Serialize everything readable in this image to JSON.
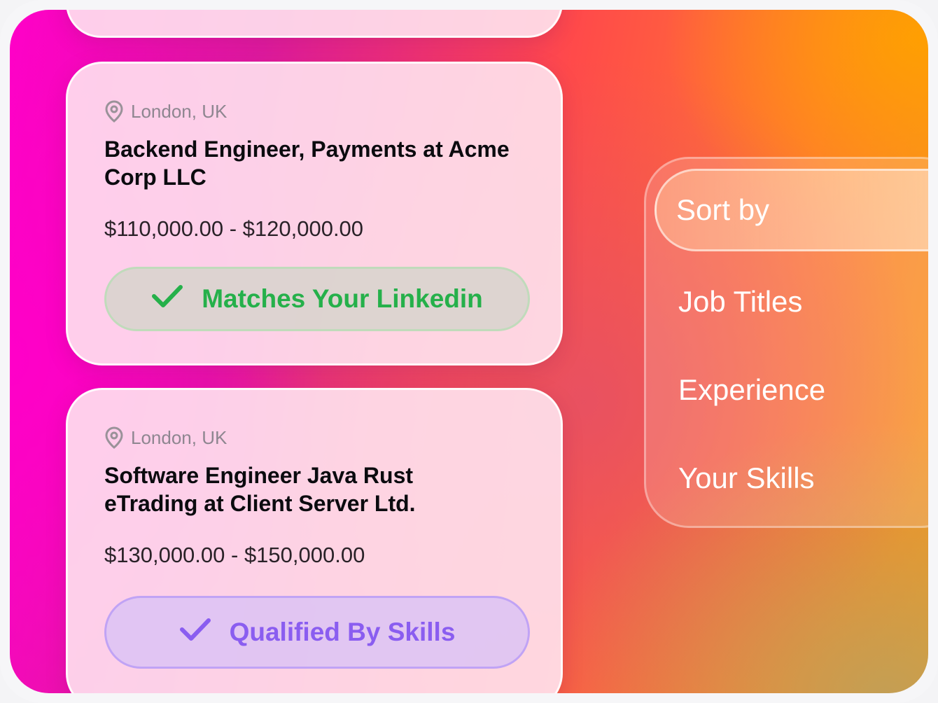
{
  "jobs": [
    {
      "location": "London, UK",
      "title": "Backend Engineer, Payments at Acme Corp LLC",
      "salary": "$110,000.00 - $120,000.00",
      "badge": "Matches Your Linkedin",
      "badge_color": "#25b04a"
    },
    {
      "location": "London, UK",
      "title": "Software Engineer Java Rust eTrading at Client Server Ltd.",
      "salary": "$130,000.00 - $150,000.00",
      "badge": "Qualified By Skills",
      "badge_color": "#8a5df0"
    }
  ],
  "sort": {
    "header": "Sort by",
    "options": [
      "Job Titles",
      "Experience",
      "Your Skills"
    ]
  },
  "icons": {
    "location": "map-pin-icon",
    "check": "check-icon"
  }
}
